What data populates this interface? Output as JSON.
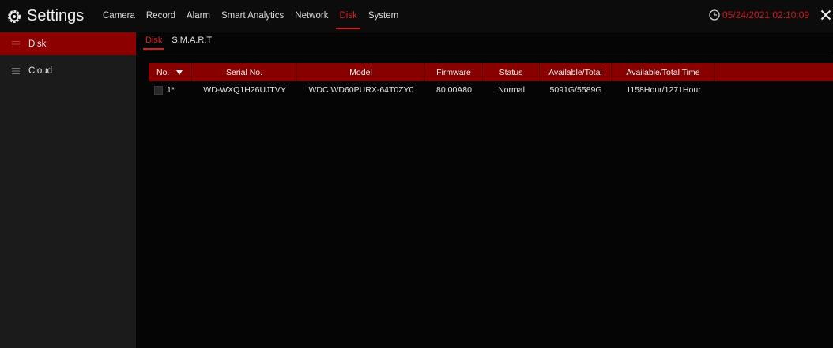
{
  "app": {
    "title": "Settings",
    "gear_icon": "gear-icon",
    "close_icon": "close-icon"
  },
  "menu": {
    "items": [
      {
        "label": "Camera"
      },
      {
        "label": "Record"
      },
      {
        "label": "Alarm"
      },
      {
        "label": "Smart Analytics"
      },
      {
        "label": "Network"
      },
      {
        "label": "Disk",
        "active": true
      },
      {
        "label": "System"
      }
    ]
  },
  "clock": {
    "datetime": "05/24/2021 02:10:09",
    "icon": "clock-icon",
    "color": "#cc1818"
  },
  "sidebar": {
    "items": [
      {
        "label": "Disk",
        "active": true,
        "icon": "list-icon"
      },
      {
        "label": "Cloud",
        "active": false,
        "icon": "list-icon"
      }
    ]
  },
  "subtabs": {
    "items": [
      {
        "label": "Disk",
        "active": true
      },
      {
        "label": "S.M.A.R.T",
        "active": false
      }
    ]
  },
  "table": {
    "columns": [
      "No.",
      "Serial No.",
      "Model",
      "Firmware",
      "Status",
      "Available/Total",
      "Available/Total Time",
      ""
    ],
    "sort_icon": "triangle-down-icon",
    "rows": [
      {
        "no": "1*",
        "serial": "WD-WXQ1H26UJTVY",
        "model": "WDC WD60PURX-64T0ZY0",
        "firmware": "80.00A80",
        "status": "Normal",
        "available_total": "5091G/5589G",
        "available_total_time": "1158Hour/1271Hour",
        "extra": ""
      }
    ]
  },
  "colors": {
    "accent": "#d22424",
    "header_bg": "#880000",
    "active_sidebar_bg": "#8c0000"
  }
}
